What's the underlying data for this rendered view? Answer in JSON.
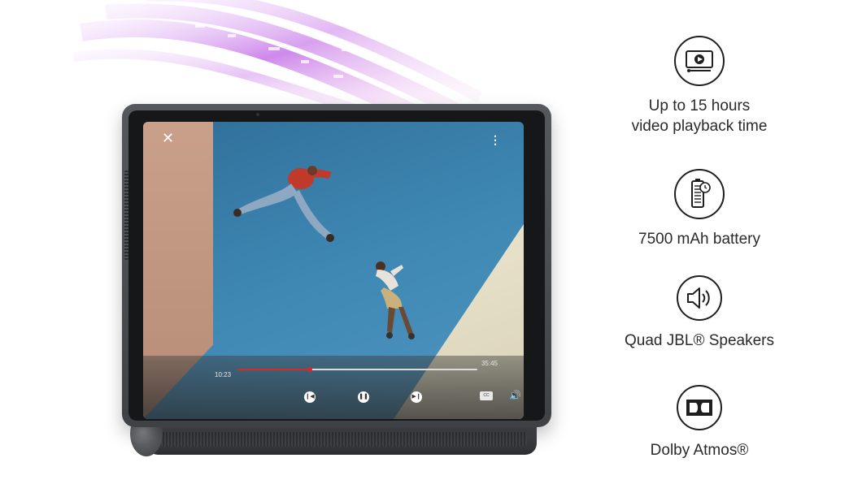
{
  "player": {
    "current_time": "10:23",
    "total_time": "35:45",
    "progress": 0.3,
    "subtitle_label": "CC"
  },
  "features": [
    {
      "icon": "video-playback-icon",
      "lines": [
        "Up to 15 hours",
        "video playback time"
      ]
    },
    {
      "icon": "battery-icon",
      "lines": [
        "7500 mAh battery"
      ]
    },
    {
      "icon": "speaker-icon",
      "lines": [
        "Quad JBL® Speakers"
      ]
    },
    {
      "icon": "dolby-icon",
      "lines": [
        "Dolby Atmos®"
      ]
    }
  ],
  "colors": {
    "progress_accent": "#d32b2b",
    "ribbon": "#c26be6",
    "screen_sky": "#3f88b4"
  }
}
